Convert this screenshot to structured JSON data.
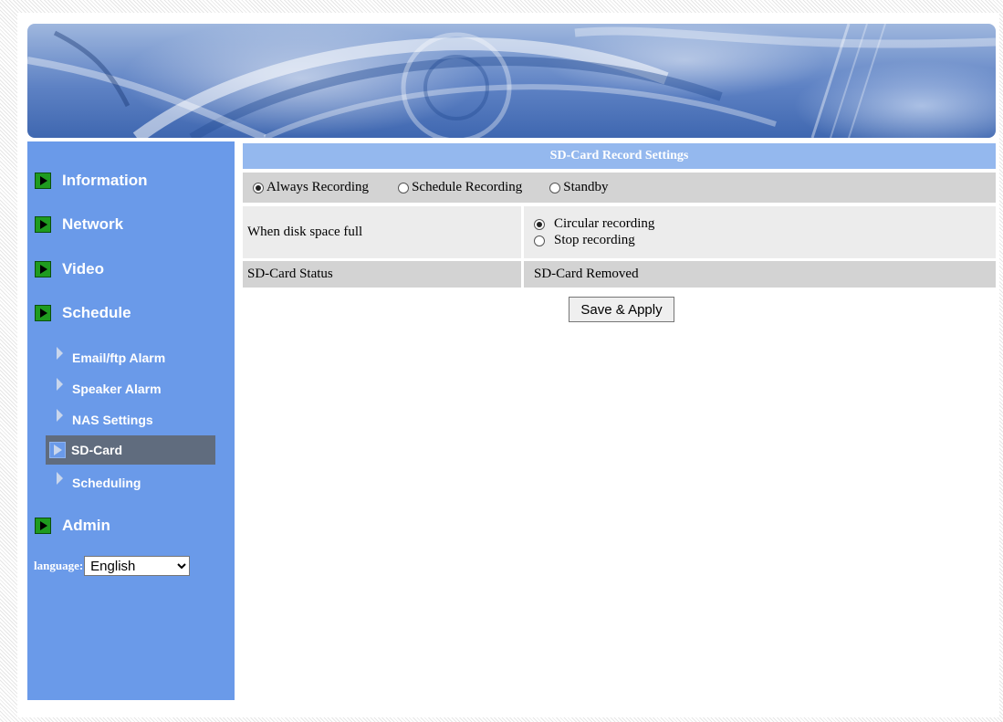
{
  "sidebar": {
    "main_items": [
      {
        "label": "Information"
      },
      {
        "label": "Network"
      },
      {
        "label": "Video"
      },
      {
        "label": "Schedule"
      },
      {
        "label": "Admin"
      }
    ],
    "sub_items": [
      {
        "label": "Email/ftp Alarm"
      },
      {
        "label": "Speaker Alarm"
      },
      {
        "label": "NAS Settings"
      },
      {
        "label": "SD-Card",
        "active": true
      },
      {
        "label": "Scheduling"
      }
    ],
    "language_label": "language:",
    "language_value": "English"
  },
  "main": {
    "title": "SD-Card Record Settings",
    "modes": [
      {
        "label": "Always Recording",
        "selected": true
      },
      {
        "label": "Schedule Recording",
        "selected": false
      },
      {
        "label": "Standby",
        "selected": false
      }
    ],
    "disk_full": {
      "label": "When disk space full",
      "options": [
        {
          "label": "Circular recording",
          "selected": true
        },
        {
          "label": "Stop recording",
          "selected": false
        }
      ]
    },
    "status": {
      "label": "SD-Card Status",
      "value": "SD-Card Removed"
    },
    "save_label": "Save & Apply"
  },
  "colors": {
    "sidebar_bg": "#6a9ae9",
    "title_bar_bg": "#94b8ee",
    "active_item_bg": "#606c7e"
  }
}
